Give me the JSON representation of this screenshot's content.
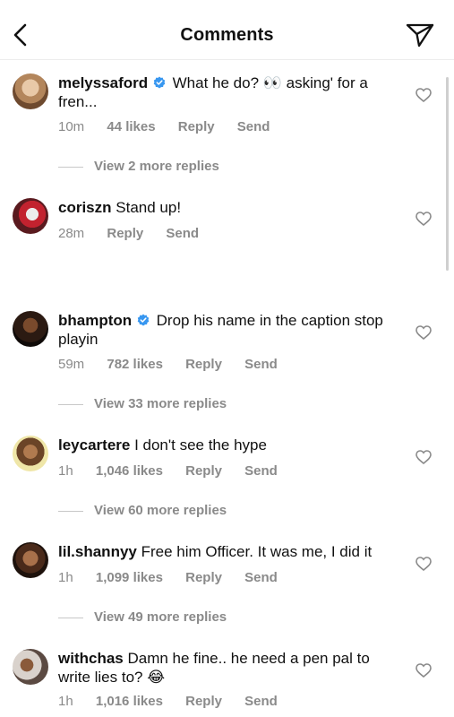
{
  "header": {
    "title": "Comments"
  },
  "comments": [
    {
      "username": "melyssaford",
      "verified": true,
      "text_a": "What he do? ",
      "emoji": "👀",
      "text_b": " asking' for a fren...",
      "time": "10m",
      "likes": "44 likes",
      "reply": "Reply",
      "send": "Send",
      "replies": "View 2 more replies"
    },
    {
      "username": "coriszn",
      "verified": false,
      "text": "Stand up!",
      "time": "28m",
      "reply": "Reply",
      "send": "Send"
    },
    {
      "username": "bhampton",
      "verified": true,
      "text": "Drop his name in the caption stop playin",
      "time": "59m",
      "likes": "782 likes",
      "reply": "Reply",
      "send": "Send",
      "replies": "View 33 more replies"
    },
    {
      "username": "leycartere",
      "verified": false,
      "text": "I don't see the hype",
      "time": "1h",
      "likes": "1,046 likes",
      "reply": "Reply",
      "send": "Send",
      "replies": "View 60 more replies"
    },
    {
      "username": "lil.shannyy",
      "verified": false,
      "text": "Free him Officer. It was me, I did it",
      "time": "1h",
      "likes": "1,099 likes",
      "reply": "Reply",
      "send": "Send",
      "replies": "View 49 more replies"
    },
    {
      "username": "withchas",
      "verified": false,
      "text_a": "Damn he fine.. he need a pen pal to write lies to? ",
      "emoji": "😂",
      "time": "1h",
      "likes": "1,016 likes",
      "reply": "Reply",
      "send": "Send"
    }
  ],
  "colors": {
    "verified": "#3897f0",
    "meta": "#8a8a8a"
  }
}
